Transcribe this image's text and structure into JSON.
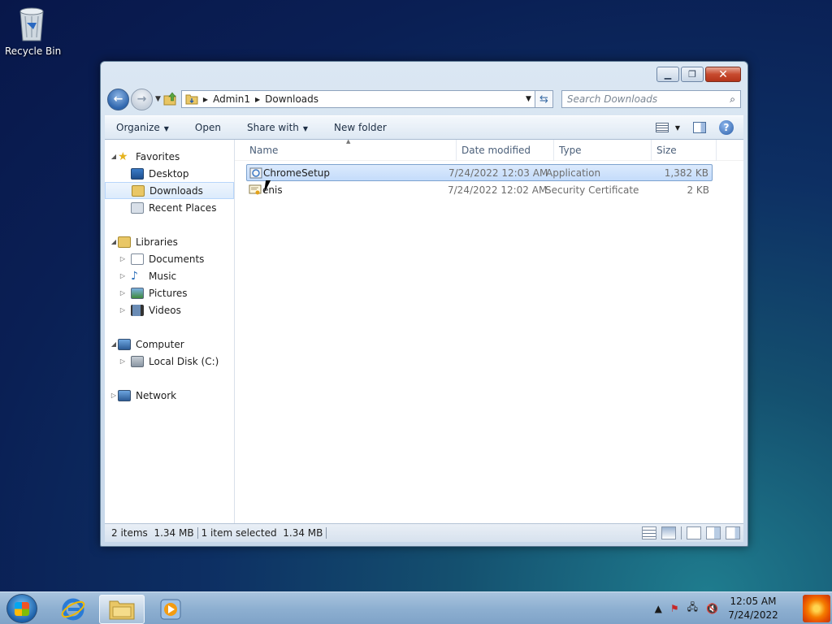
{
  "desktop": {
    "recycle_bin_label": "Recycle Bin"
  },
  "window": {
    "address": {
      "segments": [
        "Admin1",
        "Downloads"
      ]
    },
    "search_placeholder": "Search Downloads",
    "toolbar": {
      "organize": "Organize",
      "open": "Open",
      "share_with": "Share with",
      "new_folder": "New folder"
    },
    "nav": {
      "favorites": "Favorites",
      "favorites_items": [
        "Desktop",
        "Downloads",
        "Recent Places"
      ],
      "libraries": "Libraries",
      "libraries_items": [
        "Documents",
        "Music",
        "Pictures",
        "Videos"
      ],
      "computer": "Computer",
      "computer_items": [
        "Local Disk (C:)"
      ],
      "network": "Network"
    },
    "columns": {
      "name": "Name",
      "date": "Date modified",
      "type": "Type",
      "size": "Size"
    },
    "files": [
      {
        "name": "ChromeSetup",
        "date": "7/24/2022 12:03 AM",
        "type": "Application",
        "size": "1,382 KB"
      },
      {
        "name": "enis",
        "date": "7/24/2022 12:02 AM",
        "type": "Security Certificate",
        "size": "2 KB"
      }
    ],
    "status": {
      "count": "2 items",
      "total_size": "1.34 MB",
      "selected": "1 item selected",
      "selected_size": "1.34 MB"
    }
  },
  "taskbar": {
    "time": "12:05 AM",
    "date": "7/24/2022"
  },
  "colors": {
    "selection": "#c4dcfb",
    "taskbar": "#8eb0d1",
    "close_button": "#c74a2e"
  }
}
